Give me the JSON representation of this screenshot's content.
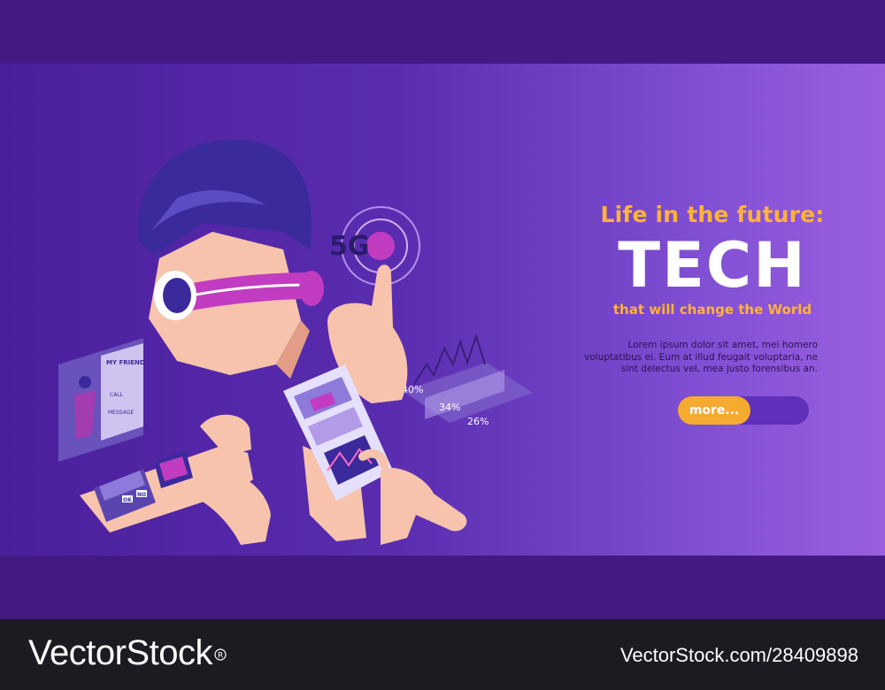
{
  "banner": {
    "subtitle": "Life in the future:",
    "headline": "TECH",
    "tagline": "that will change the World",
    "body": "Lorem ipsum dolor sit amet, mei homero voluptatibus ei. Eum at illud feugait voluptaria, ne sint delectus vel, mea justo forensibus an.",
    "more_label": "more..."
  },
  "illustration": {
    "network_label": "5G",
    "contact_card": {
      "title": "MY FRIEND",
      "call": "CALL",
      "message": "MESSAGE"
    },
    "watch_buttons": {
      "ok": "OK",
      "no": "NO"
    },
    "chart_labels": [
      "40%",
      "34%",
      "26%"
    ]
  },
  "watermark": {
    "logo": "VectorStock",
    "id": "VectorStock.com/28409898"
  },
  "colors": {
    "accent": "#f5aa30",
    "headline_orange": "#ffb23a",
    "banner_dark": "#4a1f9c",
    "banner_light": "#9b5fe0",
    "band": "#431a82"
  }
}
